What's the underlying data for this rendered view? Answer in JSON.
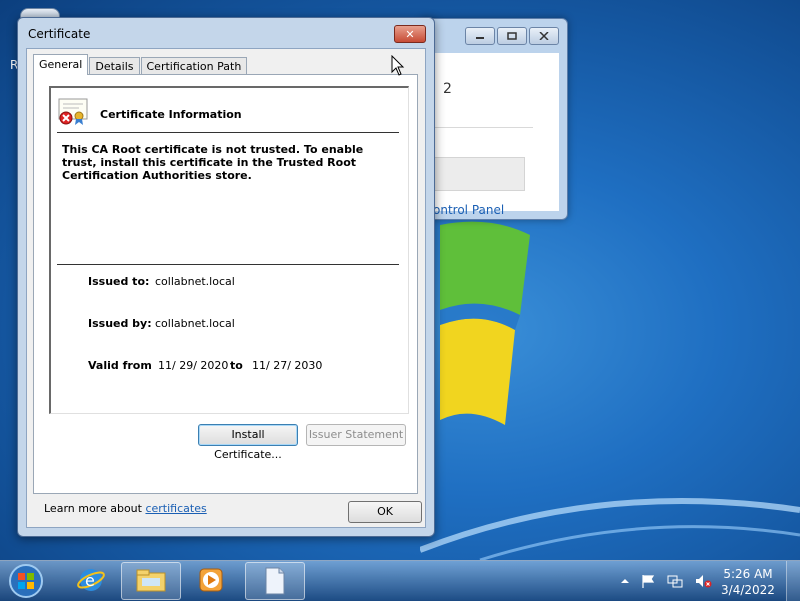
{
  "background_window": {
    "text_fragment": "2",
    "link": "ontrol Panel",
    "buttons": [
      "minimize",
      "maximize",
      "close"
    ]
  },
  "desktop": {
    "letter_fragment": "R"
  },
  "dialog": {
    "title": "Certificate",
    "close_symbol": "✕",
    "tabs": [
      {
        "label": "General",
        "active": true
      },
      {
        "label": "Details",
        "active": false
      },
      {
        "label": "Certification Path",
        "active": false
      }
    ],
    "info": {
      "heading": "Certificate Information",
      "warning": "This CA Root certificate is not trusted. To enable trust, install this certificate in the Trusted Root Certification Authorities store.",
      "issued_to_label": "Issued to:",
      "issued_to_value": "collabnet.local",
      "issued_by_label": "Issued by:",
      "issued_by_value": "collabnet.local",
      "valid_from_label": "Valid from",
      "valid_from_value": "11/ 29/ 2020",
      "to_label": "to",
      "valid_to_value": "11/ 27/ 2030"
    },
    "install_button": "Install Certificate...",
    "issuer_button": "Issuer Statement",
    "learn_prefix": "Learn more about ",
    "learn_link": "certificates",
    "ok_button": "OK"
  },
  "taskbar": {
    "time": "5:26 AM",
    "date": "3/4/2022",
    "items": [
      "start-button",
      "internet-explorer",
      "windows-explorer",
      "media-player",
      "notepad-window"
    ]
  },
  "colors": {
    "link": "#1a5fb4",
    "dialog_frame": "#c4d6ea",
    "close_button": "#c74b35"
  }
}
